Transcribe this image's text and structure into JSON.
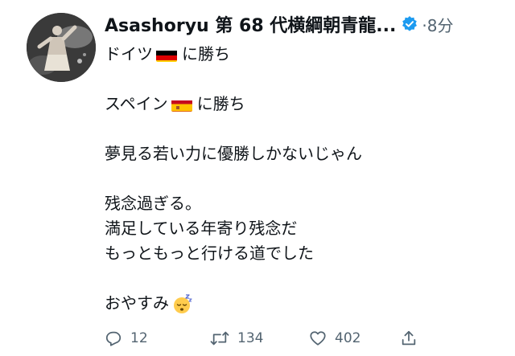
{
  "header": {
    "name": "Asashoryu 第 68 代横綱朝青龍...",
    "time": "·8分"
  },
  "body": {
    "line1": "ドイツ",
    "line1_suffix": "に勝ち",
    "line2": "スペイン",
    "line2_suffix": "に勝ち",
    "line3": "夢見る若い力に優勝しかないじゃん",
    "line4": "残念過ぎる。",
    "line5": "満足している年寄り残念だ",
    "line6": "もっともっと行ける道でした",
    "line7": "おやすみ"
  },
  "actions": {
    "reply_count": "12",
    "retweet_count": "134",
    "like_count": "402"
  },
  "colors": {
    "text": "#0f1419",
    "muted": "#536471",
    "verified": "#1d9bf0"
  },
  "icons": {
    "verified": "verified-badge-icon",
    "reply": "reply-icon",
    "retweet": "retweet-icon",
    "like": "heart-icon",
    "share": "share-icon"
  }
}
